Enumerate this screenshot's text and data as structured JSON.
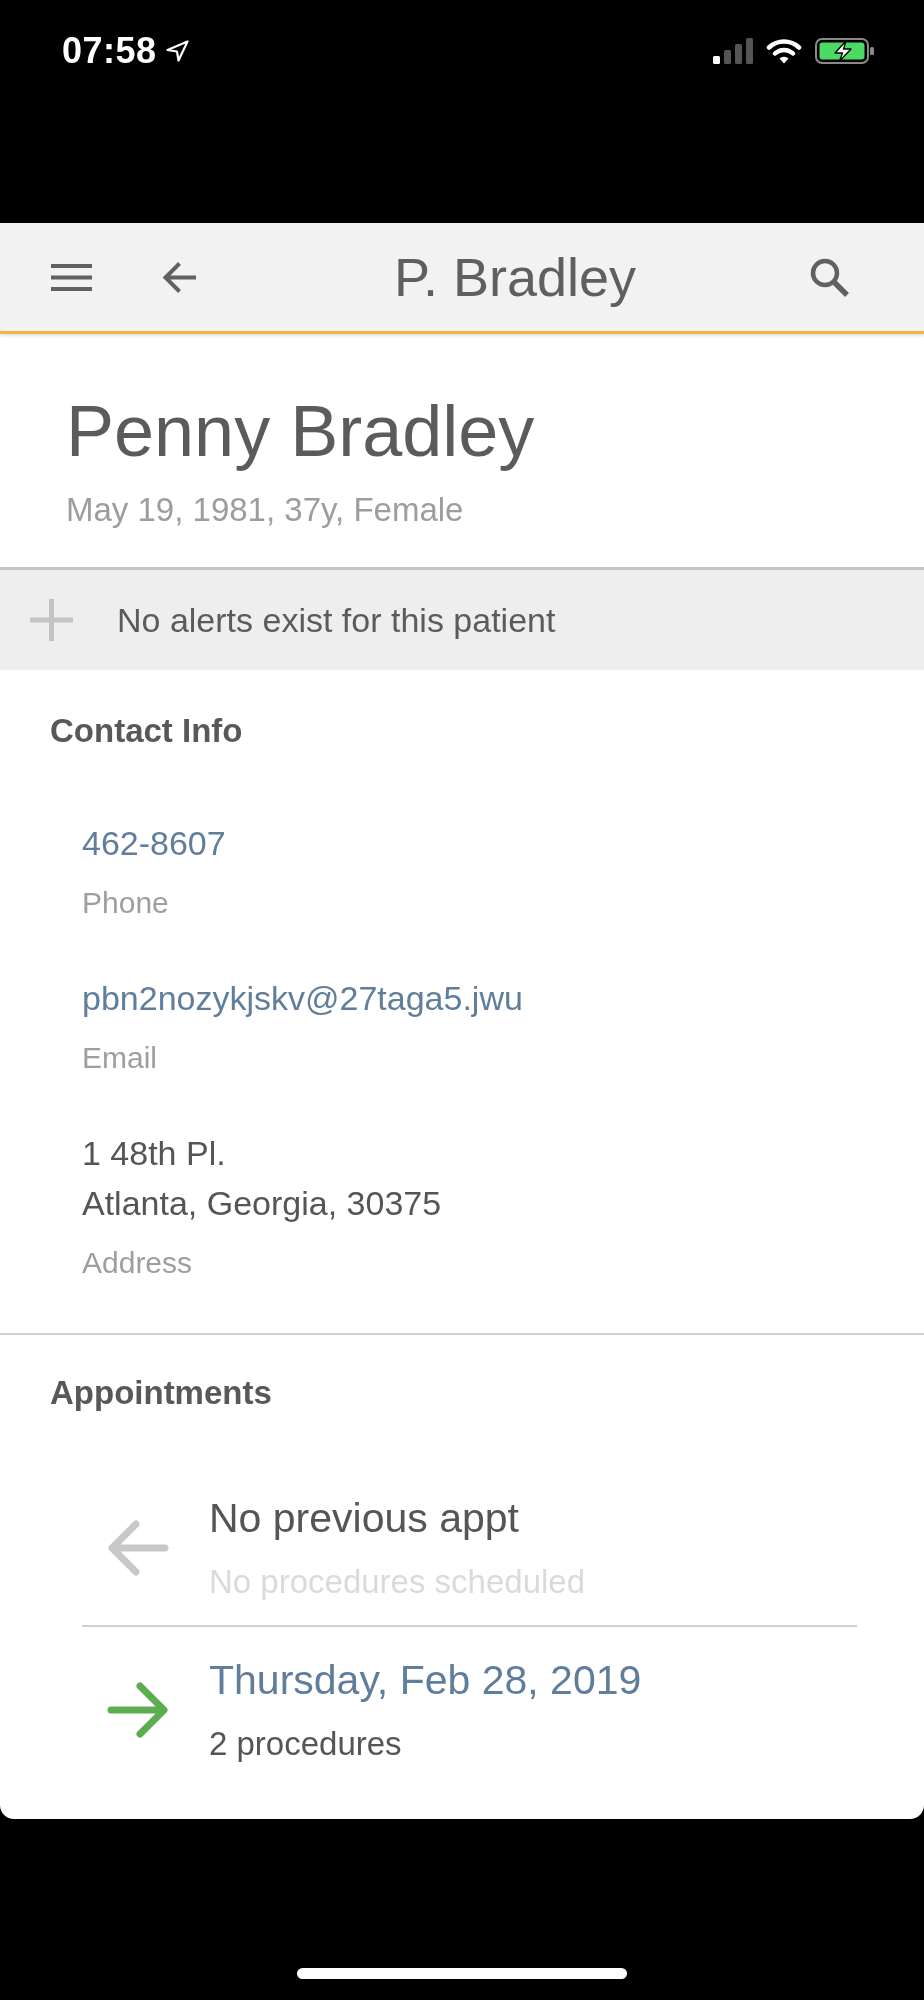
{
  "status_bar": {
    "time": "07:58"
  },
  "app_bar": {
    "title": "P. Bradley"
  },
  "patient": {
    "name": "Penny Bradley",
    "details": "May 19, 1981, 37y, Female"
  },
  "alerts": {
    "message": "No alerts exist for this patient"
  },
  "contact_info": {
    "title": "Contact Info",
    "fields": [
      {
        "kind": "link",
        "lines": [
          "462-8607"
        ],
        "label": "Phone"
      },
      {
        "kind": "link",
        "lines": [
          "pbn2nozykjskv@27taga5.jwu"
        ],
        "label": "Email"
      },
      {
        "kind": "text",
        "lines": [
          "1 48th Pl.",
          "Atlanta, Georgia, 30375"
        ],
        "label": "Address"
      }
    ]
  },
  "appointments": {
    "title": "Appointments",
    "items": [
      {
        "kind": "previous",
        "title": "No previous appt",
        "subtitle": "No procedures scheduled",
        "disabled": true
      },
      {
        "kind": "next",
        "title": "Thursday, Feb 28, 2019",
        "subtitle": "2 procedures",
        "disabled": false
      }
    ]
  }
}
